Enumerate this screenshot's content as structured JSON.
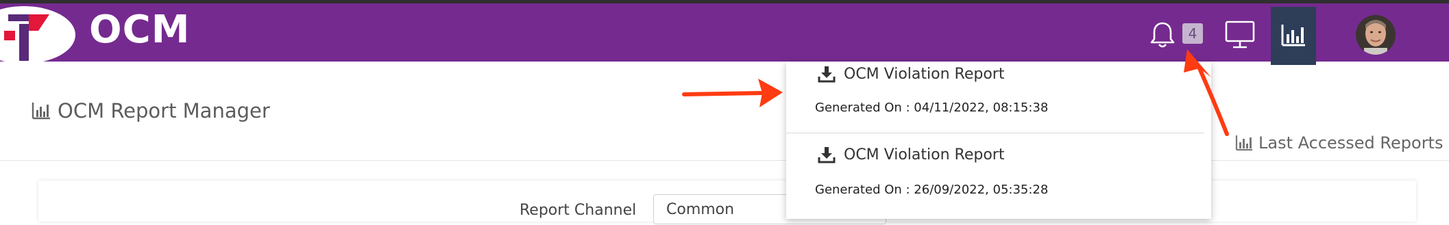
{
  "app": {
    "brand": "OCM",
    "page_title": "OCM Report Manager"
  },
  "header": {
    "notification_count": "4",
    "icons": [
      "bell-icon",
      "monitor-icon",
      "bar-chart-icon",
      "avatar"
    ]
  },
  "notifications": [
    {
      "title": "OCM Violation Report",
      "meta": "Generated On : 04/11/2022, 08:15:38"
    },
    {
      "title": "OCM Violation Report",
      "meta": "Generated On : 26/09/2022, 05:35:28"
    }
  ],
  "sidebar_link": {
    "label": "Last Accessed Reports"
  },
  "filters": {
    "report_channel_label": "Report Channel",
    "report_channel_value": "Common"
  },
  "colors": {
    "header_bg": "#752a8f",
    "active_tab_bg": "#2e3e58",
    "badge_bg": "#c5b5cf",
    "annotation_arrow": "#ff3b12"
  }
}
